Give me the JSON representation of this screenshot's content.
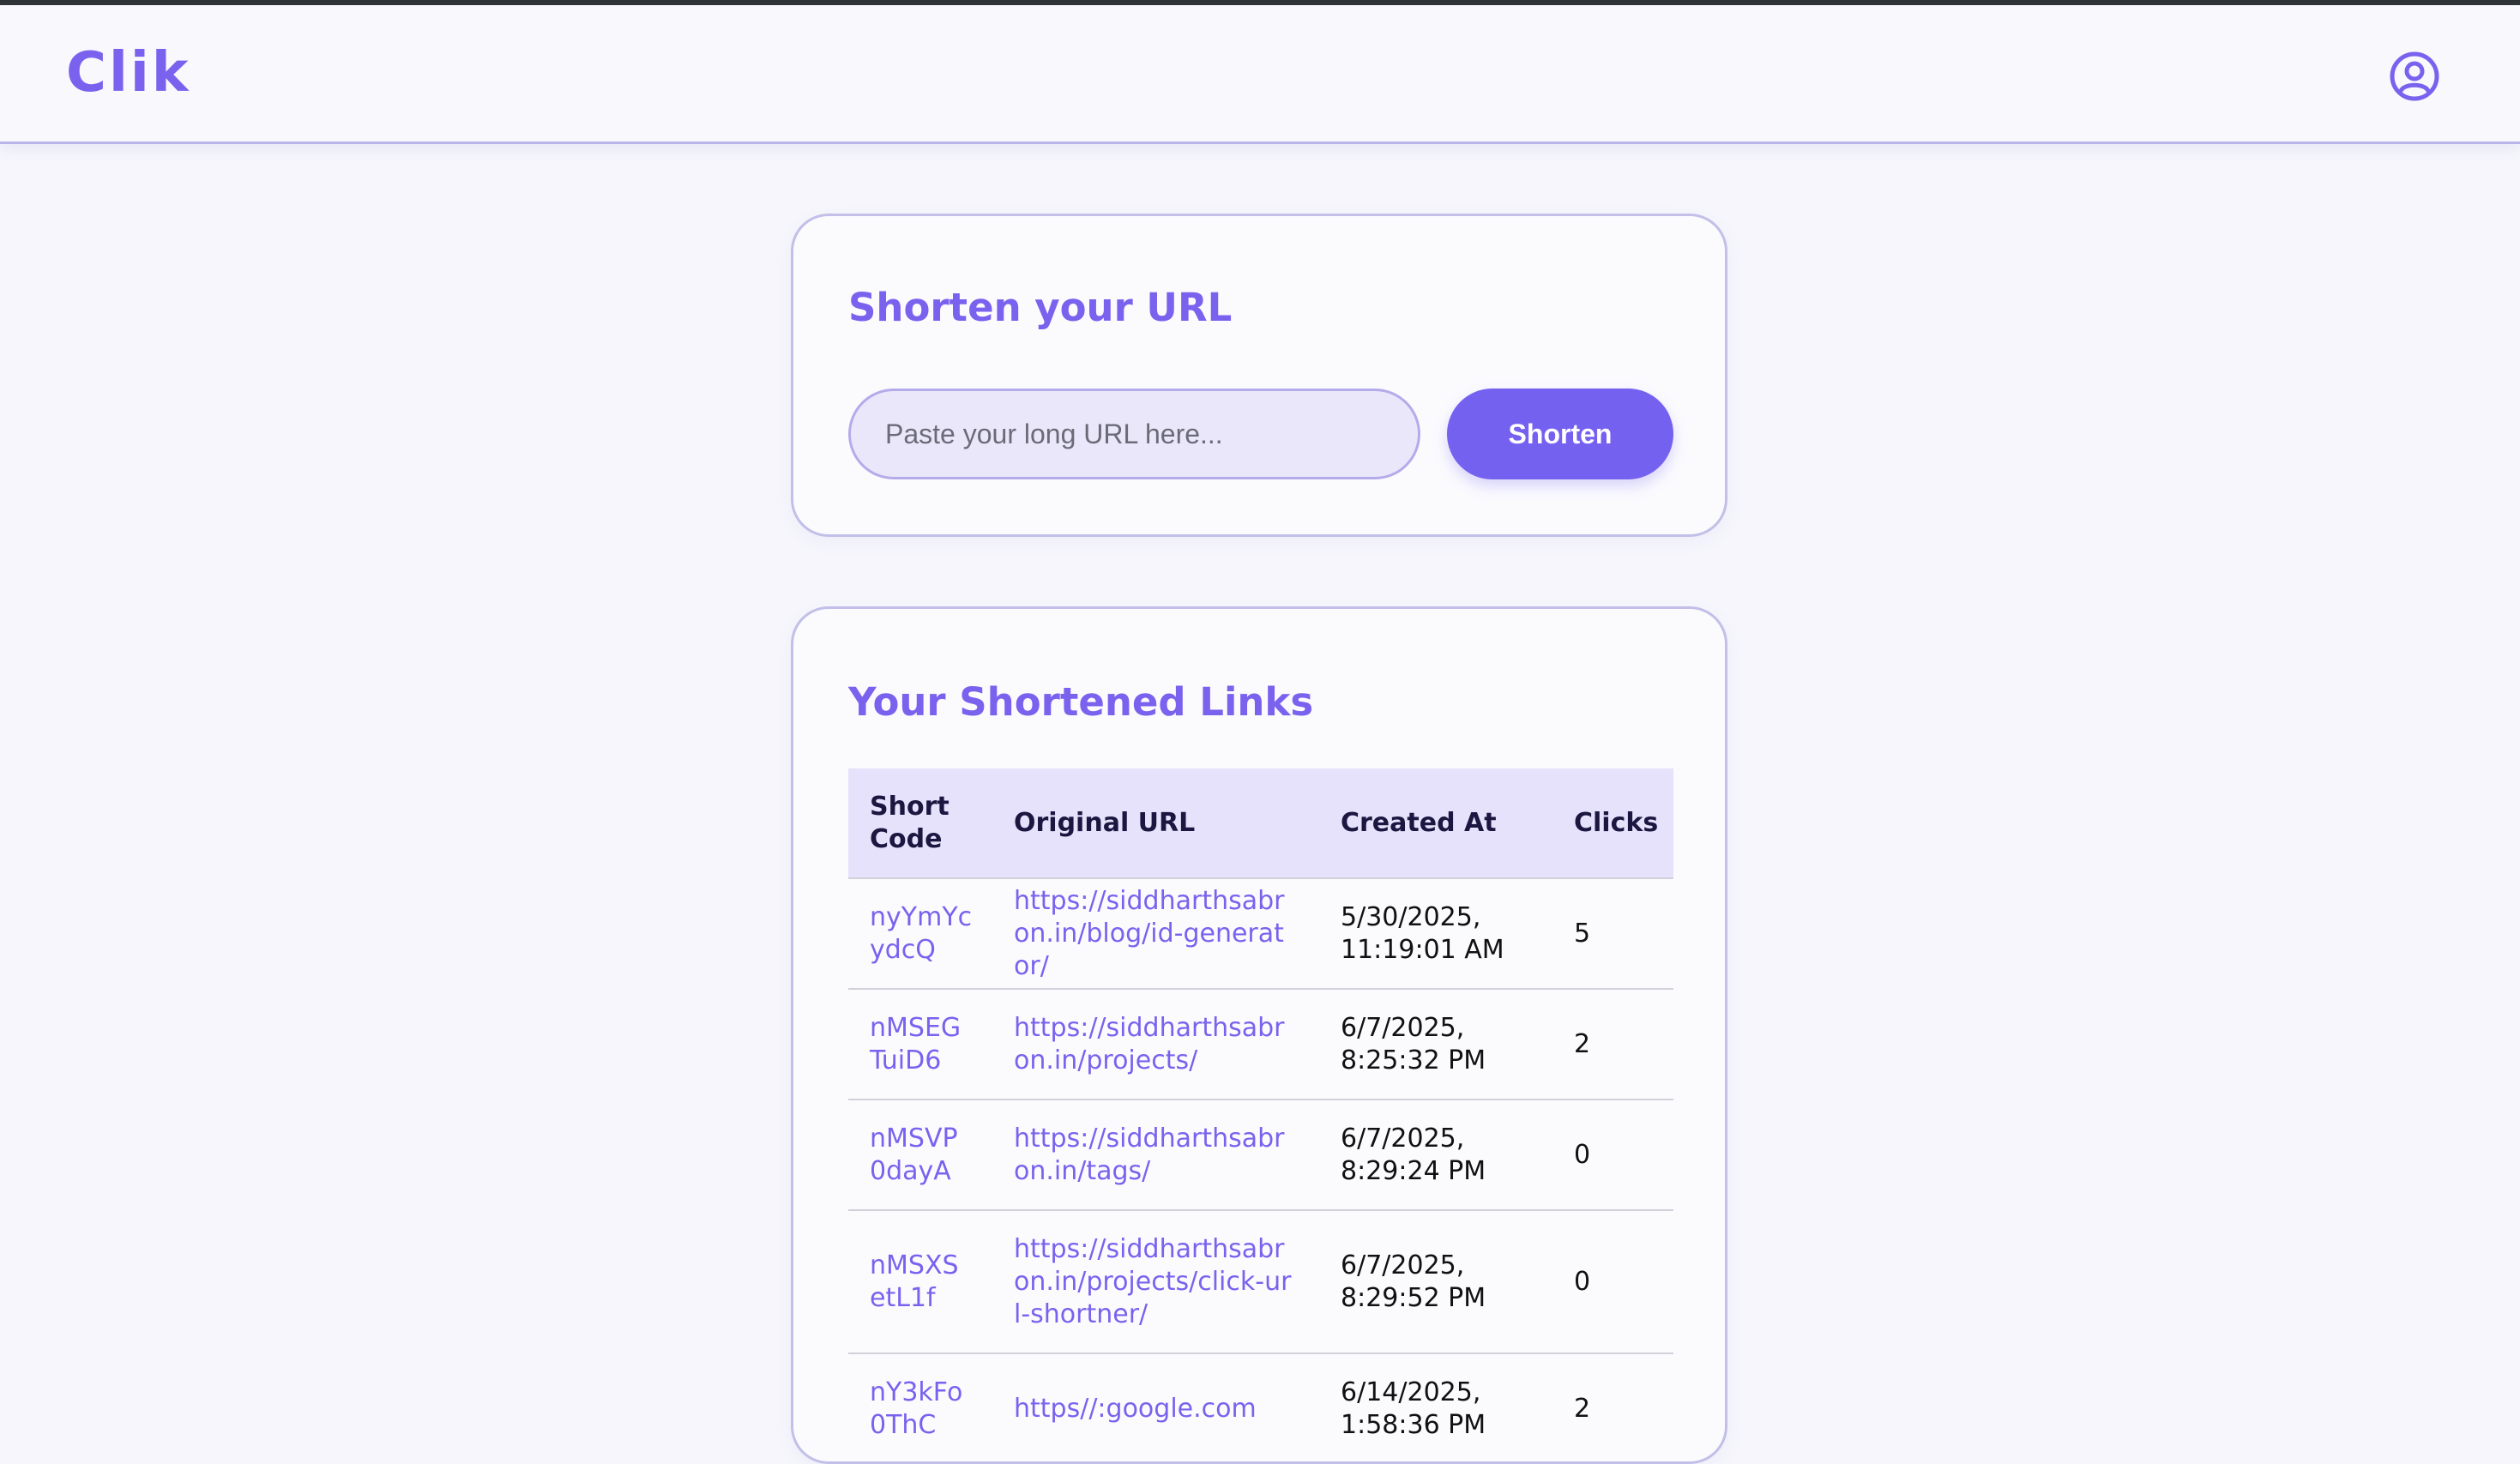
{
  "app": {
    "logo": "Clik"
  },
  "shorten_card": {
    "title": "Shorten your URL",
    "input_placeholder": "Paste your long URL here...",
    "button_label": "Shorten"
  },
  "links_card": {
    "title": "Your Shortened Links",
    "columns": [
      "Short Code",
      "Original URL",
      "Created At",
      "Clicks"
    ],
    "rows": [
      {
        "code": "nyYmYcydcQ",
        "url": "https://siddharthsabron.in/blog/id-generator/",
        "created": "5/30/2025, 11:19:01 AM",
        "clicks": "5"
      },
      {
        "code": "nMSEGTuiD6",
        "url": "https://siddharthsabron.in/projects/",
        "created": "6/7/2025, 8:25:32 PM",
        "clicks": "2"
      },
      {
        "code": "nMSVP0dayA",
        "url": "https://siddharthsabron.in/tags/",
        "created": "6/7/2025, 8:29:24 PM",
        "clicks": "0"
      },
      {
        "code": "nMSXSetL1f",
        "url": "https://siddharthsabron.in/projects/click-url-shortner/",
        "created": "6/7/2025, 8:29:52 PM",
        "clicks": "0"
      },
      {
        "code": "nY3kFo0ThC",
        "url": "https//:google.com",
        "created": "6/14/2025, 1:58:36 PM",
        "clicks": "2"
      }
    ]
  },
  "colors": {
    "accent": "#7561f0",
    "brand_text": "#7a62ee",
    "header_bg": "#e6e2fb"
  },
  "icons": {
    "profile": "user-circle-icon"
  }
}
